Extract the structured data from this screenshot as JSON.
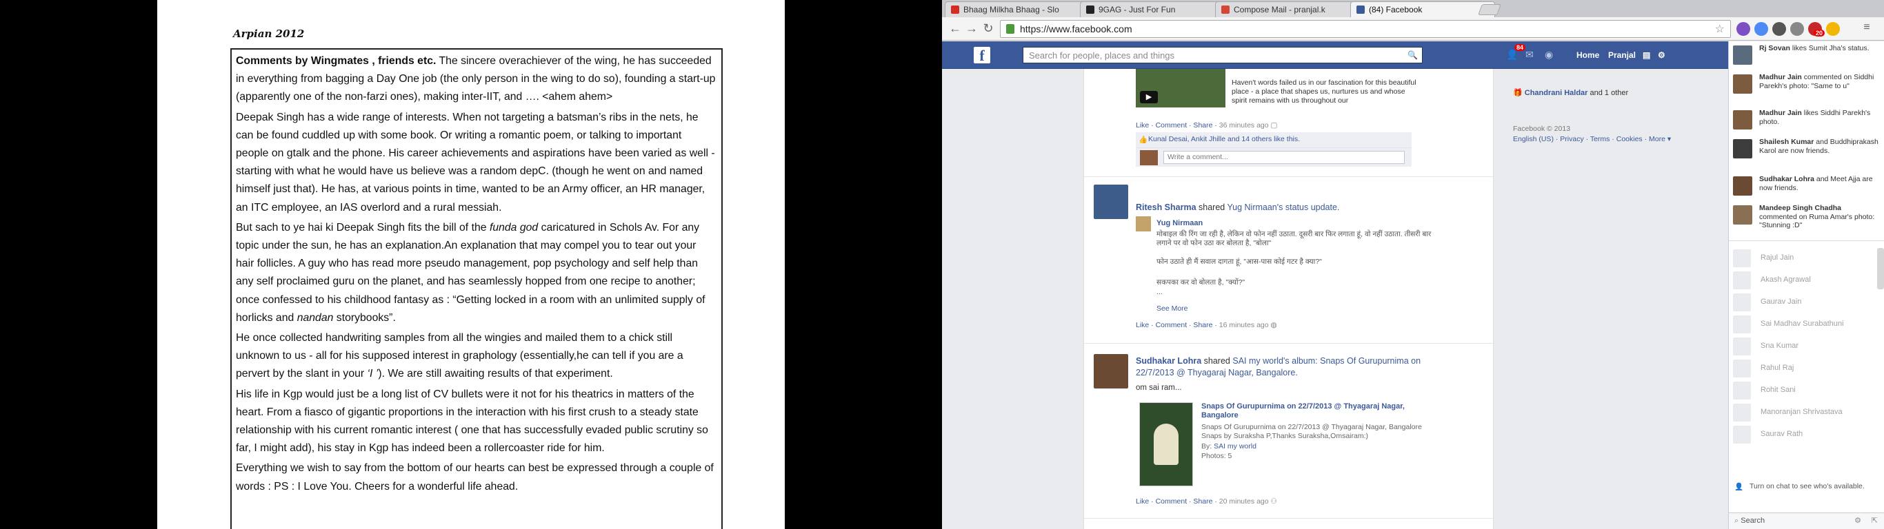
{
  "document": {
    "header": "Arpian 2012",
    "paragraphs": [
      {
        "bold": "Comments by Wingmates , friends etc.",
        "text": " The sincere overachiever of the wing, he has succeeded in everything from bagging a Day One job (the only person in the wing to do so), founding a start-up (apparently one of the non-farzi ones), making inter-IIT, and …. <ahem ahem>"
      },
      {
        "text": "Deepak Singh has a wide range of interests. When not targeting a batsman’s ribs in the nets, he can be found cuddled up with some book. Or writing a romantic poem, or talking to important people on gtalk and the phone. His career achievements and aspirations have been varied as well - starting with what he would have us believe was a random depC. (though he went on and named himself just that). He has, at various points in time, wanted to be an Army officer, an HR manager, an ITC employee, an IAS overlord and a rural messiah."
      },
      {
        "text_a": "But sach to ye hai ki Deepak Singh fits the bill of the ",
        "italic_a": "funda god",
        "text_b": " caricatured in Schols Av. For any topic under the sun, he has an explanation.An explanation that may compel you to tear out your hair follicles. A guy who has read more pseudo management, pop psychology and self help than any self proclaimed guru on the planet, and has seamlessly hopped from one recipe to another; once confessed to his childhood fantasy as : “Getting locked in a room with an unlimited supply of horlicks and ",
        "italic_b": "nandan",
        "text_c": " storybooks”."
      },
      {
        "text_a": "He once collected handwriting samples from all the wingies and mailed them to a chick still unknown to us - all for his supposed interest in graphology (essentially,he can tell if you are a pervert by the slant in your  ",
        "italic_a": "‘I ’",
        "text_b": "). We are still awaiting results of that experiment."
      },
      {
        "text": "His life in Kgp would just be a long list of CV bullets were it not for his theatrics in matters of the heart. From a fiasco of gigantic proportions in the interaction with his first crush to a steady state relationship with his current romantic interest ( one that has successfully evaded public scrutiny so far, I might add), his stay in Kgp has indeed been a rollercoaster ride for him."
      },
      {
        "text": "Everything we wish to say from the bottom of our hearts can best be expressed through a couple of words :  PS : I Love You. Cheers for a wonderful life ahead."
      }
    ]
  },
  "browser": {
    "tabs": [
      {
        "label": "Bhaag Milkha Bhaag - Slo",
        "color": "#d62b22",
        "active": false
      },
      {
        "label": "9GAG - Just For Fun",
        "color": "#222222",
        "active": false
      },
      {
        "label": "Compose Mail - pranjal.k",
        "color": "#d44638",
        "active": false
      },
      {
        "label": "(84) Facebook",
        "color": "#3b5998",
        "active": true
      }
    ],
    "url": "https://www.facebook.com"
  },
  "facebook": {
    "search_placeholder": "Search for people, places and things",
    "notif_count": "84",
    "ext_badge": "20",
    "nav": {
      "home": "Home",
      "profile": "Pranjal"
    },
    "post1": {
      "desc": "Haven't words failed us in our fascination for this beautiful place - a place that shapes us, nurtures us and whose spirit remains with us throughout our",
      "actions": "Like · Comment · Share ·",
      "time": "36 minutes ago",
      "likes": "Kunal Desai, Ankit Jhille and 14 others like this.",
      "comment_placeholder": "Write a comment..."
    },
    "post2": {
      "name": "Ritesh Sharma",
      "shared": "shared",
      "owner": "Yug Nirmaan's status update.",
      "sub_name": "Yug Nirmaan",
      "hindi1": "मोबाइल की रिंग जा रही है, लेकिन वो फोन नहीं उठाता. दूसरी बार फिर लगाता हूं, वो नहीं उठाता. तीसरी बार लगाने पर वो फोन उठा कर बोलता है, \"बोला\"",
      "hindi2": "फोन उठाते ही मैं सवाल दागता हूं, \"आस-पास कोई गटर है क्या?\"",
      "hindi3": "सकपका कर वो बोलता है, \"क्यों?\"",
      "ellipsis": "...",
      "see_more": "See More",
      "actions": "Like · Comment · Share ·",
      "time": "16 minutes ago"
    },
    "post3": {
      "name": "Sudhakar Lohra",
      "shared": "shared",
      "owner": "SAI my world",
      "album": "'s album: Snaps Of Gurupurnima on 22/7/2013 @ Thyagaraj Nagar, Bangalore.",
      "text": "om sai ram...",
      "att_title": "Snaps Of Gurupurnima on 22/7/2013 @ Thyagaraj Nagar, Bangalore",
      "att_desc": "Snaps Of Gurupurnima on 22/7/2013 @ Thyagaraj Nagar, Bangalore Snaps by Suraksha P,Thanks Suraksha,Omsairam:)",
      "by_label": "By:",
      "by": "SAI my world",
      "photos": "Photos: 5",
      "actions": "Like · Comment · Share ·",
      "time": "20 minutes ago"
    },
    "right": {
      "birthday": "Chandrani Haldar",
      "birthday_rest": " and 1 other",
      "footer1": "Facebook © 2013",
      "footer2": "English (US) · Privacy · Terms · Cookies · More ▾"
    }
  },
  "chat": {
    "ticker": [
      {
        "name": "Rj Sovan",
        "text": " likes Sumit Jha's status."
      },
      {
        "name": "Madhur Jain",
        "text": " commented on Siddhi Parekh's photo: \"Same to u\""
      },
      {
        "name": "Madhur Jain",
        "text": " likes Siddhi Parekh's photo."
      },
      {
        "name": "Shailesh Kumar",
        "text": " and Buddhiprakash Karol are now friends."
      },
      {
        "name": "Sudhakar Lohra",
        "text": " and Meet Ajja are now friends."
      },
      {
        "name": "Mandeep Singh Chadha",
        "text": " commented on Ruma Amar's photo: \"Stunning :D\""
      }
    ],
    "buddies": [
      "Rajul Jain",
      "Akash Agrawal",
      "Gaurav Jain",
      "Sai Madhav Surabathuni",
      "Sna Kumar",
      "Rahul Raj",
      "Rohit Sani",
      "Manoranjan Shrivastava",
      "Saurav Rath"
    ],
    "turn_on": "Turn on chat to see who's available.",
    "search": "Search"
  }
}
